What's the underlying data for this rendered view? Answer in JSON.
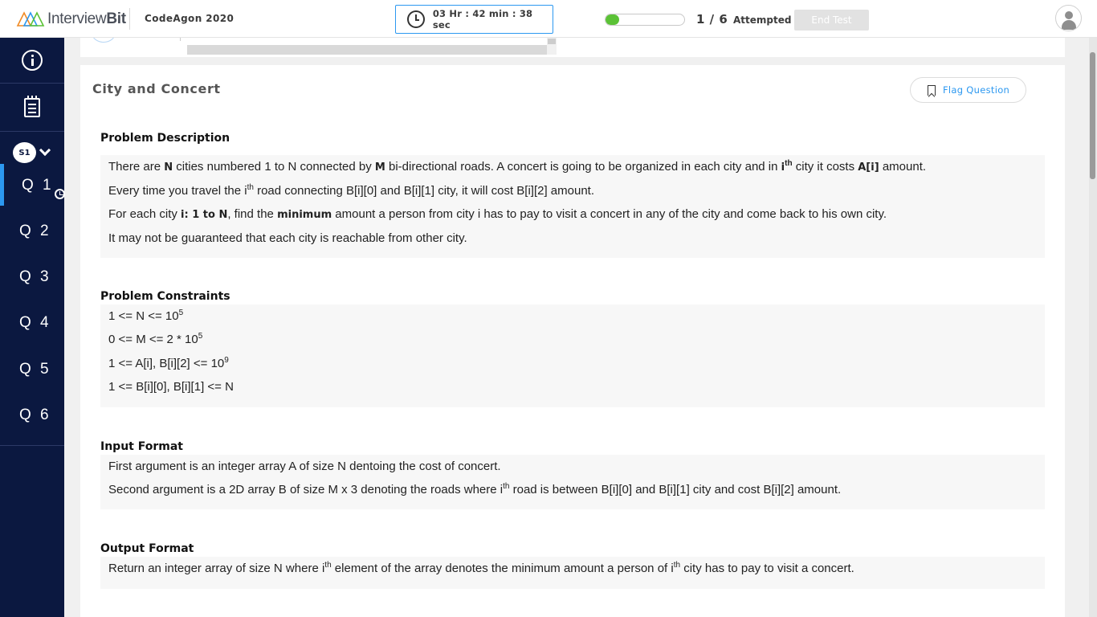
{
  "header": {
    "brand_name": "InterviewBit",
    "contest_title": "CodeAgon 2020",
    "timer": "03 Hr : 42 min : 38 sec",
    "progress_fraction": 0.17,
    "attempted_count": "1 / 6",
    "attempted_label": "Attempted",
    "end_test_label": "End Test",
    "colors": {
      "progress": "#5bc236",
      "timer_border": "#2c98f0",
      "sidebar": "#0b1840"
    }
  },
  "sidebar": {
    "section_badge": "S1",
    "questions": [
      {
        "label": "Q 1",
        "active": true
      },
      {
        "label": "Q 2"
      },
      {
        "label": "Q 3"
      },
      {
        "label": "Q 4"
      },
      {
        "label": "Q 5"
      },
      {
        "label": "Q 6"
      }
    ],
    "icons": [
      "info-icon",
      "list-icon",
      "chevron-down-icon",
      "clock-icon"
    ]
  },
  "problem": {
    "title": "City and Concert",
    "flag_label": "Flag Question",
    "description": {
      "heading": "Problem Description",
      "l1": {
        "a": "There are ",
        "n": "N",
        "b": " cities numbered 1 to N connected by ",
        "m": "M",
        "c": " bi-directional roads. A concert is going to be organized in each city and in ",
        "i": "i",
        "th": "th",
        "d": " city it costs ",
        "ai": "A[i]",
        "e": " amount."
      },
      "l2": {
        "a": "Every time you travel the i",
        "th": "th",
        "b": " road connecting B[i][0] and B[i][1] city, it will cost B[i][2] amount."
      },
      "l3": {
        "a": "For each city ",
        "range": "i: 1 to N",
        "b": ", find the ",
        "min": "minimum",
        "c": " amount a person from city i has to pay to visit a concert in any of the city and come back to his own city."
      },
      "l4": "It may not be guaranteed that each city is reachable from other city."
    },
    "constraints": {
      "heading": "Problem Constraints",
      "c1": {
        "a": "1 <= N <= 10",
        "exp": "5"
      },
      "c2": {
        "a": "0 <= M <= 2 * 10",
        "exp": "5"
      },
      "c3": {
        "a": "1 <= A[i], B[i][2] <= 10",
        "exp": "9"
      },
      "c4": "1 <= B[i][0], B[i][1] <= N"
    },
    "input_format": {
      "heading": "Input Format",
      "l1": "First argument is an integer array A of size N dentoing the cost of concert.",
      "l2": {
        "a": "Second argument is a 2D array B of size M x 3 denoting the roads where i",
        "th": "th",
        "b": " road is between B[i][0] and B[i][1] city and cost B[i][2] amount."
      }
    },
    "output_format": {
      "heading": "Output Format",
      "l1": {
        "a": "Return an integer array of size N where i",
        "th": "th",
        "b": " element of the array denotes the minimum amount a person of i",
        "th2": "th",
        "c": " city has to pay to visit a concert."
      }
    }
  }
}
